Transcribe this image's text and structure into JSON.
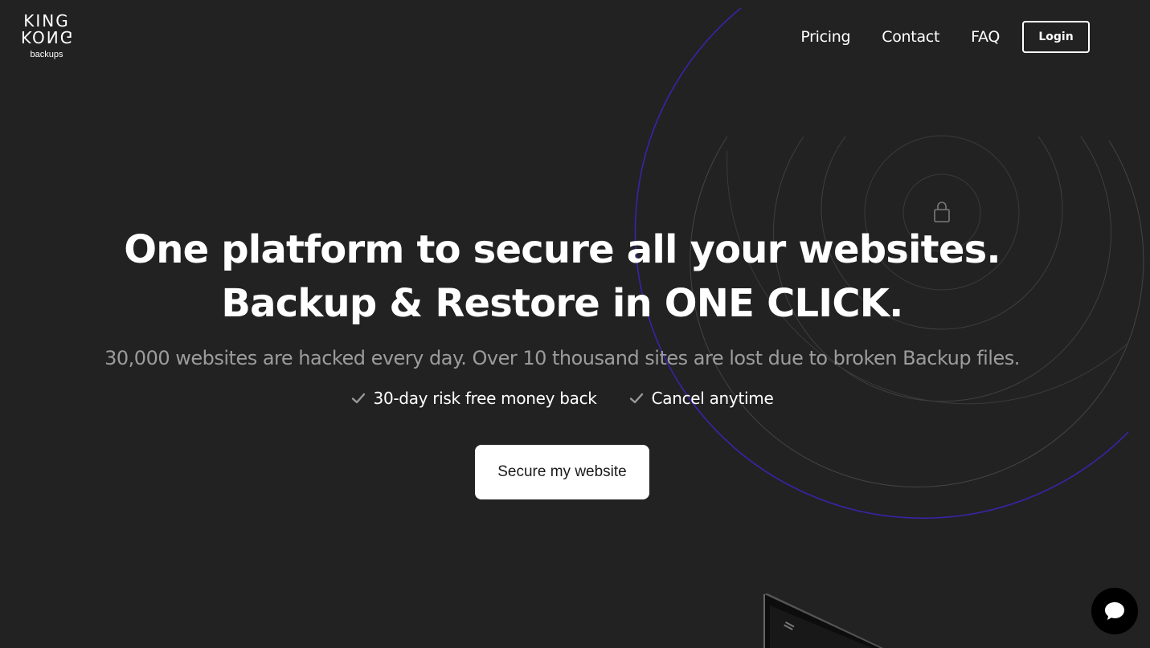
{
  "brand": {
    "line1": "KING",
    "line2": "KONG",
    "line3": "backups"
  },
  "nav": {
    "links": [
      "Pricing",
      "Contact",
      "FAQ"
    ],
    "login_label": "Login"
  },
  "hero": {
    "headline_line1": "One platform to secure all your websites.",
    "headline_line2": "Backup & Restore in ONE CLICK.",
    "subheadline": "30,000 websites are hacked every day. Over 10 thousand sites are lost due to broken Backup files.",
    "checks": [
      "30-day risk free money back",
      "Cancel anytime"
    ],
    "cta_label": "Secure my website"
  },
  "colors": {
    "background": "#222222",
    "accent_ring": "#3a23a8",
    "subtext": "#9c9c9c"
  },
  "icons": {
    "lock": "lock-icon",
    "check": "check-icon",
    "chat": "chat-icon"
  }
}
